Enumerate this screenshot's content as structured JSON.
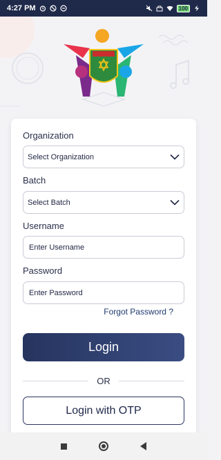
{
  "status_bar": {
    "time": "4:27 PM",
    "battery": "100"
  },
  "form": {
    "organization_label": "Organization",
    "organization_value": "Select Organization",
    "batch_label": "Batch",
    "batch_value": "Select Batch",
    "username_label": "Username",
    "username_placeholder": "Enter Username",
    "password_label": "Password",
    "password_placeholder": "Enter Password",
    "forgot_password": "Forgot Password ?",
    "login_button": "Login",
    "or_divider": "OR",
    "otp_button": "Login with OTP"
  },
  "colors": {
    "status_bar": "#1f2a4a",
    "primary": "#26345e",
    "background": "#f3f3f6"
  }
}
